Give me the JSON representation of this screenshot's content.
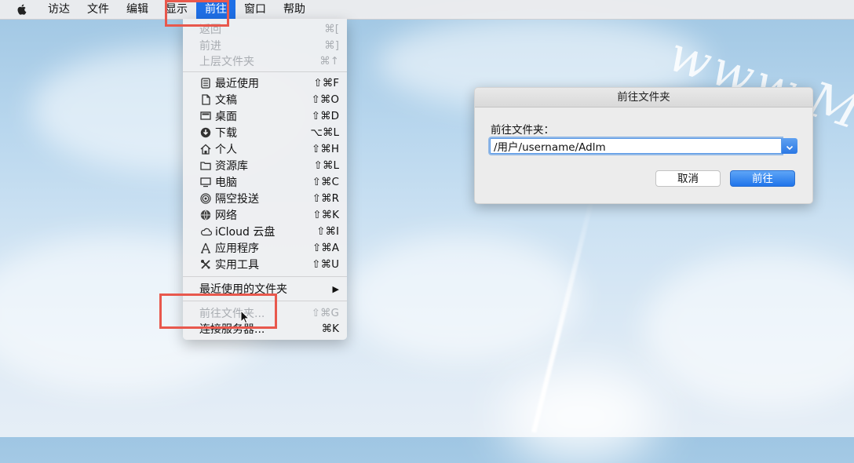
{
  "menubar": {
    "items": [
      "访达",
      "文件",
      "编辑",
      "显示",
      "前往",
      "窗口",
      "帮助"
    ],
    "active_index": 4
  },
  "go_menu": {
    "items": [
      {
        "label": "返回",
        "shortcut": "⌘[",
        "disabled": true,
        "icon": "none"
      },
      {
        "label": "前进",
        "shortcut": "⌘]",
        "disabled": true,
        "icon": "none"
      },
      {
        "label": "上层文件夹",
        "shortcut": "⌘↑",
        "disabled": true,
        "icon": "none"
      },
      {
        "label": "最近使用",
        "shortcut": "⇧⌘F",
        "icon": "recents-icon"
      },
      {
        "label": "文稿",
        "shortcut": "⇧⌘O",
        "icon": "documents-icon"
      },
      {
        "label": "桌面",
        "shortcut": "⇧⌘D",
        "icon": "desktop-icon"
      },
      {
        "label": "下载",
        "shortcut": "⌥⌘L",
        "icon": "download-icon"
      },
      {
        "label": "个人",
        "shortcut": "⇧⌘H",
        "icon": "home-icon"
      },
      {
        "label": "资源库",
        "shortcut": "⇧⌘L",
        "icon": "folder-icon"
      },
      {
        "label": "电脑",
        "shortcut": "⇧⌘C",
        "icon": "computer-icon"
      },
      {
        "label": "隔空投送",
        "shortcut": "⇧⌘R",
        "icon": "airdrop-icon"
      },
      {
        "label": "网络",
        "shortcut": "⇧⌘K",
        "icon": "network-icon"
      },
      {
        "label": "iCloud 云盘",
        "shortcut": "⇧⌘I",
        "icon": "cloud-icon"
      },
      {
        "label": "应用程序",
        "shortcut": "⇧⌘A",
        "icon": "applications-icon"
      },
      {
        "label": "实用工具",
        "shortcut": "⇧⌘U",
        "icon": "utilities-icon"
      },
      {
        "label": "最近使用的文件夹",
        "shortcut": "▶",
        "icon": "none"
      },
      {
        "label": "前往文件夹...",
        "shortcut": "⇧⌘G",
        "disabled": true,
        "icon": "none"
      },
      {
        "label": "连接服务器...",
        "shortcut": "⌘K",
        "icon": "none"
      }
    ]
  },
  "dialog": {
    "title": "前往文件夹",
    "prompt": "前往文件夹：",
    "path_value": "/用户/username/Adlm",
    "cancel_label": "取消",
    "go_label": "前往"
  },
  "watermark": "www.Mac",
  "colors": {
    "accent": "#1e6fe6",
    "highlight_box": "#e8584d"
  }
}
